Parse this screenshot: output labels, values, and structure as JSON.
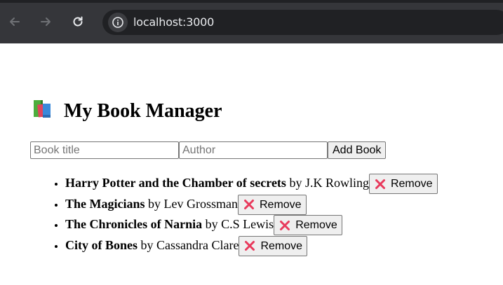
{
  "browser": {
    "url": "localhost:3000",
    "icons": [
      "back-arrow-icon",
      "forward-arrow-icon",
      "reload-icon",
      "info-icon"
    ]
  },
  "app": {
    "title_emoji": "📚",
    "title": "My Book Manager"
  },
  "form": {
    "title_placeholder": "Book title",
    "author_placeholder": "Author",
    "title_value": "",
    "author_value": "",
    "add_label": "Add Book"
  },
  "books": [
    {
      "title": "Harry Potter and the Chamber of secrets",
      "by": " by J.K Rowling",
      "remove_label": "Remove"
    },
    {
      "title": "The Magicians",
      "by": " by Lev Grossman",
      "remove_label": "Remove"
    },
    {
      "title": "The Chronicles of Narnia",
      "by": " by C.S Lewis",
      "remove_label": "Remove"
    },
    {
      "title": "City of Bones",
      "by": " by Cassandra Clare",
      "remove_label": "Remove"
    }
  ],
  "colors": {
    "browser_bg": "#35363a",
    "omnibox_bg": "#202124",
    "remove_x": "#e8395b",
    "button_bg": "#efefef"
  }
}
